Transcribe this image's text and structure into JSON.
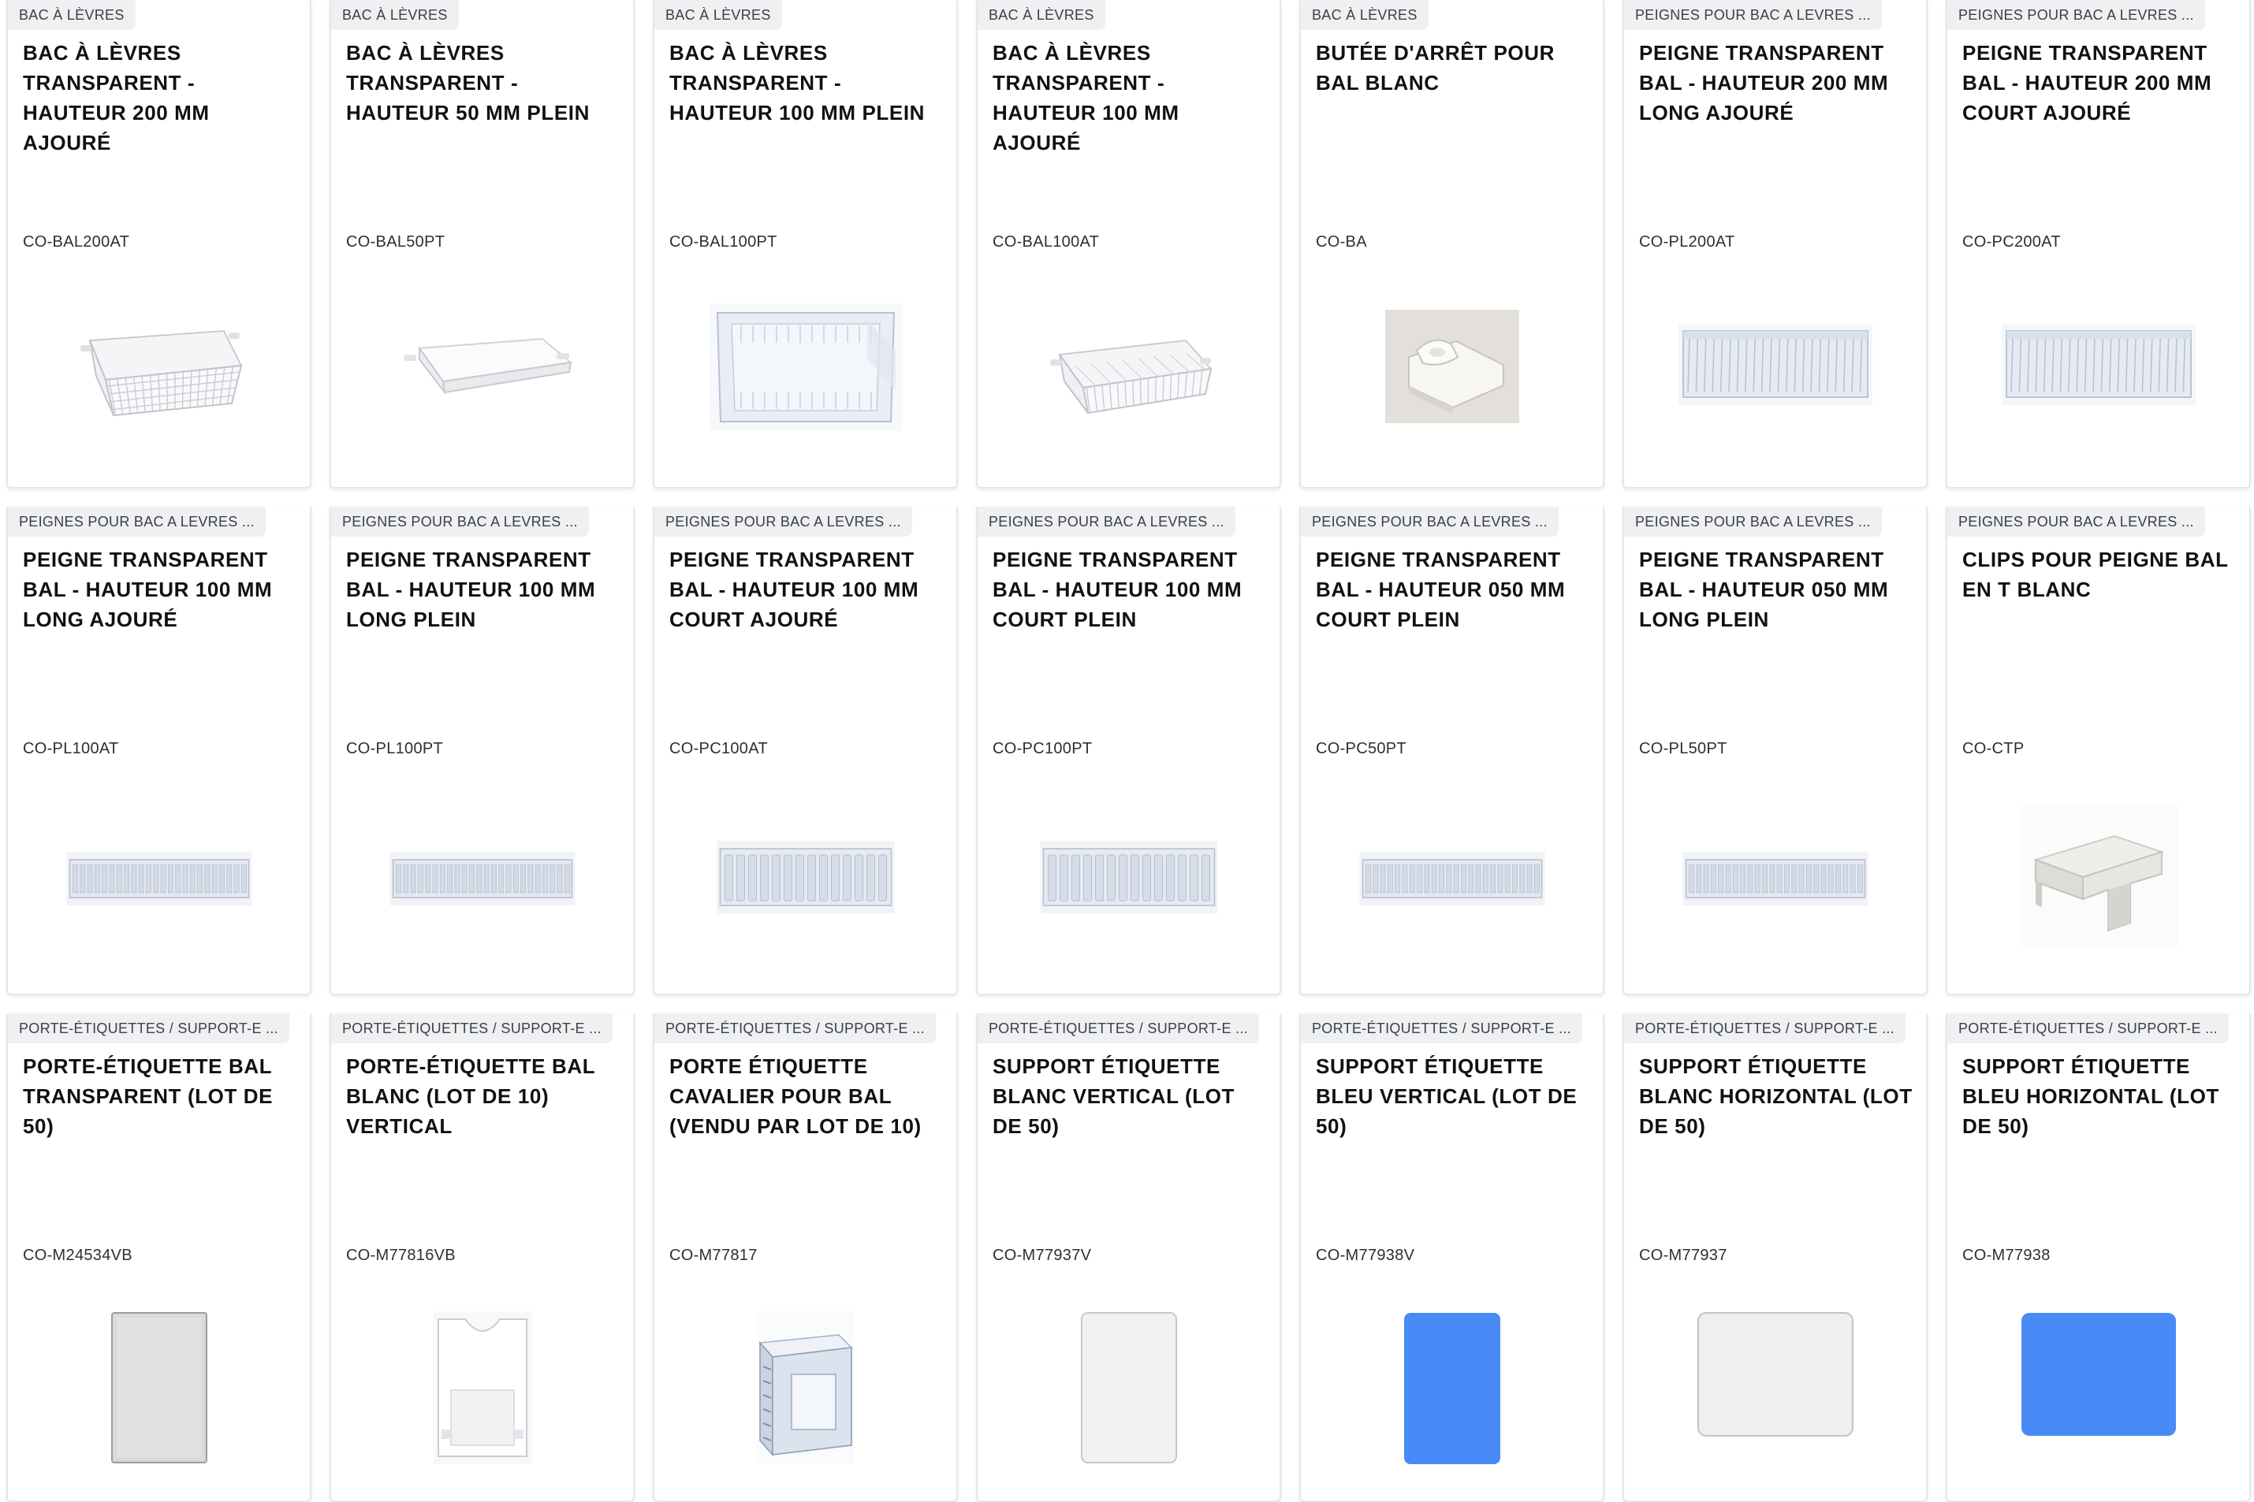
{
  "products": [
    {
      "category": "BAC À LÈVRES",
      "title": "BAC À LÈVRES TRANSPARENT - HAUTEUR 200 MM AJOURÉ",
      "ref": "CO-BAL200AT",
      "image": "wire-basket-tall"
    },
    {
      "category": "BAC À LÈVRES",
      "title": "BAC À LÈVRES TRANSPARENT - HAUTEUR 50 MM PLEIN",
      "ref": "CO-BAL50PT",
      "image": "flat-tray"
    },
    {
      "category": "BAC À LÈVRES",
      "title": "BAC À LÈVRES TRANSPARENT - HAUTEUR 100 MM PLEIN",
      "ref": "CO-BAL100PT",
      "image": "clear-tray"
    },
    {
      "category": "BAC À LÈVRES",
      "title": "BAC À LÈVRES TRANSPARENT - HAUTEUR 100 MM AJOURÉ",
      "ref": "CO-BAL100AT",
      "image": "wire-basket-low"
    },
    {
      "category": "BAC À LÈVRES",
      "title": "BUTÉE D'ARRÊT POUR BAL BLANC",
      "ref": "CO-BA",
      "image": "stopper"
    },
    {
      "category": "PEIGNES POUR BAC A LEVRES ...",
      "title": "PEIGNE TRANSPARENT BAL - HAUTEUR 200 MM LONG AJOURÉ",
      "ref": "CO-PL200AT",
      "image": "comb-big"
    },
    {
      "category": "PEIGNES POUR BAC A LEVRES ...",
      "title": "PEIGNE TRANSPARENT BAL - HAUTEUR 200 MM COURT AJOURÉ",
      "ref": "CO-PC200AT",
      "image": "comb-big"
    },
    {
      "category": "PEIGNES POUR BAC A LEVRES ...",
      "title": "PEIGNE TRANSPARENT BAL - HAUTEUR 100 MM LONG AJOURÉ",
      "ref": "CO-PL100AT",
      "image": "comb-long"
    },
    {
      "category": "PEIGNES POUR BAC A LEVRES ...",
      "title": "PEIGNE TRANSPARENT BAL - HAUTEUR 100 MM LONG PLEIN",
      "ref": "CO-PL100PT",
      "image": "comb-long"
    },
    {
      "category": "PEIGNES POUR BAC A LEVRES ...",
      "title": "PEIGNE TRANSPARENT BAL - HAUTEUR 100 MM COURT AJOURÉ",
      "ref": "CO-PC100AT",
      "image": "comb-short"
    },
    {
      "category": "PEIGNES POUR BAC A LEVRES ...",
      "title": "PEIGNE TRANSPARENT BAL - HAUTEUR 100 MM COURT PLEIN",
      "ref": "CO-PC100PT",
      "image": "comb-short"
    },
    {
      "category": "PEIGNES POUR BAC A LEVRES ...",
      "title": "PEIGNE TRANSPARENT BAL - HAUTEUR 050 MM COURT PLEIN",
      "ref": "CO-PC50PT",
      "image": "comb-long"
    },
    {
      "category": "PEIGNES POUR BAC A LEVRES ...",
      "title": "PEIGNE TRANSPARENT BAL - HAUTEUR 050 MM LONG PLEIN",
      "ref": "CO-PL50PT",
      "image": "comb-long"
    },
    {
      "category": "PEIGNES POUR BAC A LEVRES ...",
      "title": "CLIPS POUR PEIGNE BAL EN T BLANC",
      "ref": "CO-CTP",
      "image": "t-clip"
    },
    {
      "category": "PORTE-ÉTIQUETTES / SUPPORT-E ...",
      "title": "PORTE-ÉTIQUETTE BAL TRANSPARENT (LOT DE 50)",
      "ref": "CO-M24534VB",
      "image": "label-holder-clear"
    },
    {
      "category": "PORTE-ÉTIQUETTES / SUPPORT-E ...",
      "title": "PORTE-ÉTIQUETTE BAL BLANC (LOT DE 10) VERTICAL",
      "ref": "CO-M77816VB",
      "image": "label-holder-white"
    },
    {
      "category": "PORTE-ÉTIQUETTES / SUPPORT-E ...",
      "title": "PORTE ÉTIQUETTE CAVALIER POUR BAL (VENDU PAR LOT DE 10)",
      "ref": "CO-M77817",
      "image": "rider-label"
    },
    {
      "category": "PORTE-ÉTIQUETTES / SUPPORT-E ...",
      "title": "SUPPORT ÉTIQUETTE BLANC VERTICAL (LOT DE 50)",
      "ref": "CO-M77937V",
      "image": "white-vertical"
    },
    {
      "category": "PORTE-ÉTIQUETTES / SUPPORT-E ...",
      "title": "SUPPORT ÉTIQUETTE BLEU VERTICAL (LOT DE 50)",
      "ref": "CO-M77938V",
      "image": "blue-vertical"
    },
    {
      "category": "PORTE-ÉTIQUETTES / SUPPORT-E ...",
      "title": "SUPPORT ÉTIQUETTE BLANC HORIZONTAL (LOT DE 50)",
      "ref": "CO-M77937",
      "image": "white-horizontal"
    },
    {
      "category": "PORTE-ÉTIQUETTES / SUPPORT-E ...",
      "title": "SUPPORT ÉTIQUETTE BLEU HORIZONTAL (LOT DE 50)",
      "ref": "CO-M77938",
      "image": "blue-horizontal"
    }
  ],
  "colors": {
    "category_bg": "#eef0f2",
    "card_border": "#e6e7ea",
    "label_blue": "#4a8af7"
  }
}
